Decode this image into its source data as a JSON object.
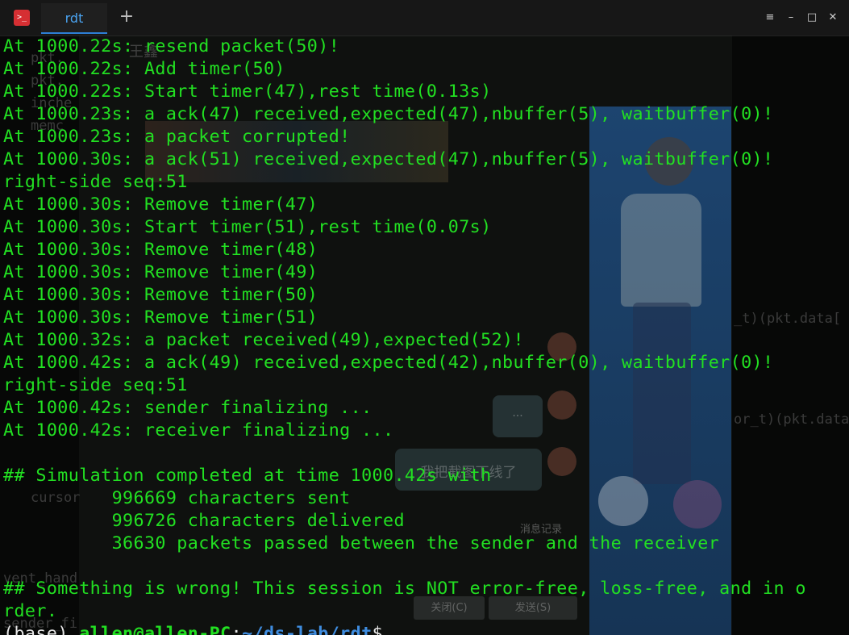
{
  "window": {
    "app_icon_glyph": ">_",
    "tab_label": "rdt",
    "new_tab_glyph": "+",
    "menu_glyph": "≡",
    "minimize_glyph": "–",
    "maximize_glyph": "□",
    "close_glyph": "✕"
  },
  "background_window": {
    "title": "王鑫",
    "bubble_1": "...",
    "bubble_2": "我把截图下线了",
    "history_label": "消息记录",
    "close_button": "关闭(C)",
    "send_button": "发送(S)",
    "code_fragments": [
      "pkt.",
      "pkt.",
      "inche",
      "memc",
      "_t)(pkt.data[",
      "or_t)(pkt.data",
      "cursor",
      "vent_hand",
      "sender_fi"
    ]
  },
  "terminal": {
    "lines": [
      "At 1000.22s: resend packet(50)!",
      "At 1000.22s: Add timer(50)",
      "At 1000.22s: Start timer(47),rest time(0.13s)",
      "At 1000.23s: a ack(47) received,expected(47),nbuffer(5), waitbuffer(0)!",
      "At 1000.23s: a packet corrupted!",
      "At 1000.30s: a ack(51) received,expected(47),nbuffer(5), waitbuffer(0)!",
      "right-side seq:51",
      "At 1000.30s: Remove timer(47)",
      "At 1000.30s: Start timer(51),rest time(0.07s)",
      "At 1000.30s: Remove timer(48)",
      "At 1000.30s: Remove timer(49)",
      "At 1000.30s: Remove timer(50)",
      "At 1000.30s: Remove timer(51)",
      "At 1000.32s: a packet received(49),expected(52)!",
      "At 1000.42s: a ack(49) received,expected(42),nbuffer(0), waitbuffer(0)!",
      "right-side seq:51",
      "At 1000.42s: sender finalizing ...",
      "At 1000.42s: receiver finalizing ...",
      "",
      "## Simulation completed at time 1000.42s with",
      "          996669 characters sent",
      "          996726 characters delivered",
      "          36630 packets passed between the sender and the receiver",
      "",
      "## Something is wrong! This session is NOT error-free, loss-free, and in o",
      "rder."
    ],
    "prompt": {
      "env": "(base) ",
      "user_host": "allen@allen-PC",
      "colon": ":",
      "path": "~/ds-lab/rdt",
      "sign": "$ "
    }
  },
  "colors": {
    "terminal_text": "#22e022",
    "path": "#3f8de0",
    "tab_accent": "#2d7fd6",
    "app_icon": "#d62f33"
  }
}
